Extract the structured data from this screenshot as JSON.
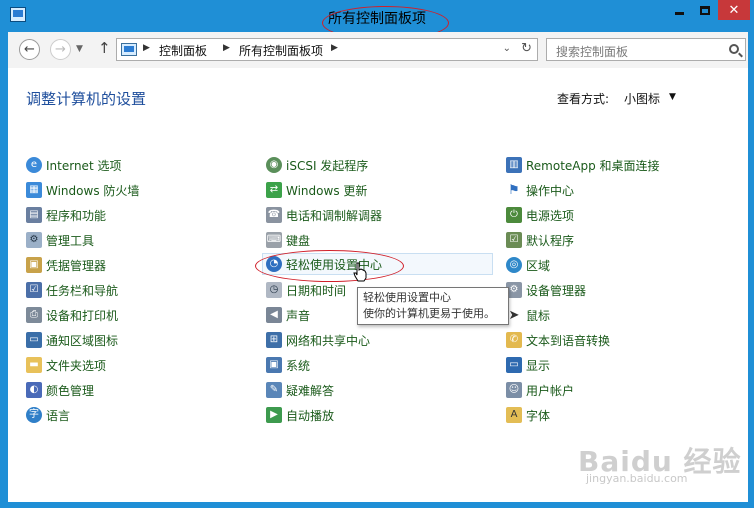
{
  "window": {
    "title": "所有控制面板项",
    "minimize_glyph": "—",
    "close_glyph": "✕"
  },
  "nav": {
    "back_glyph": "←",
    "forward_glyph": "→",
    "up_glyph": "↑",
    "breadcrumbs": [
      "控制面板",
      "所有控制面板项"
    ],
    "search_placeholder": "搜索控制面板"
  },
  "header": {
    "title": "调整计算机的设置",
    "view_by_label": "查看方式:",
    "view_by_value": "小图标"
  },
  "items": {
    "col1": [
      "Internet 选项",
      "Windows 防火墙",
      "程序和功能",
      "管理工具",
      "凭据管理器",
      "任务栏和导航",
      "设备和打印机",
      "通知区域图标",
      "文件夹选项",
      "颜色管理",
      "语言"
    ],
    "col2": [
      "iSCSI 发起程序",
      "Windows 更新",
      "电话和调制解调器",
      "键盘",
      "轻松使用设置中心",
      "日期和时间",
      "声音",
      "网络和共享中心",
      "系统",
      "疑难解答",
      "自动播放"
    ],
    "col3": [
      "RemoteApp 和桌面连接",
      "操作中心",
      "电源选项",
      "默认程序",
      "区域",
      "设备管理器",
      "鼠标",
      "文本到语音转换",
      "显示",
      "用户帐户",
      "字体"
    ]
  },
  "tooltip": {
    "line1": "轻松使用设置中心",
    "line2": "使你的计算机更易于使用。"
  },
  "watermark": {
    "brand": "Baidu 经验",
    "url": "jingyan.baidu.com"
  },
  "colors": {
    "frame": "#1f8fd6",
    "title_blue": "#1e4e9c",
    "annotation_red": "#d0202a"
  }
}
